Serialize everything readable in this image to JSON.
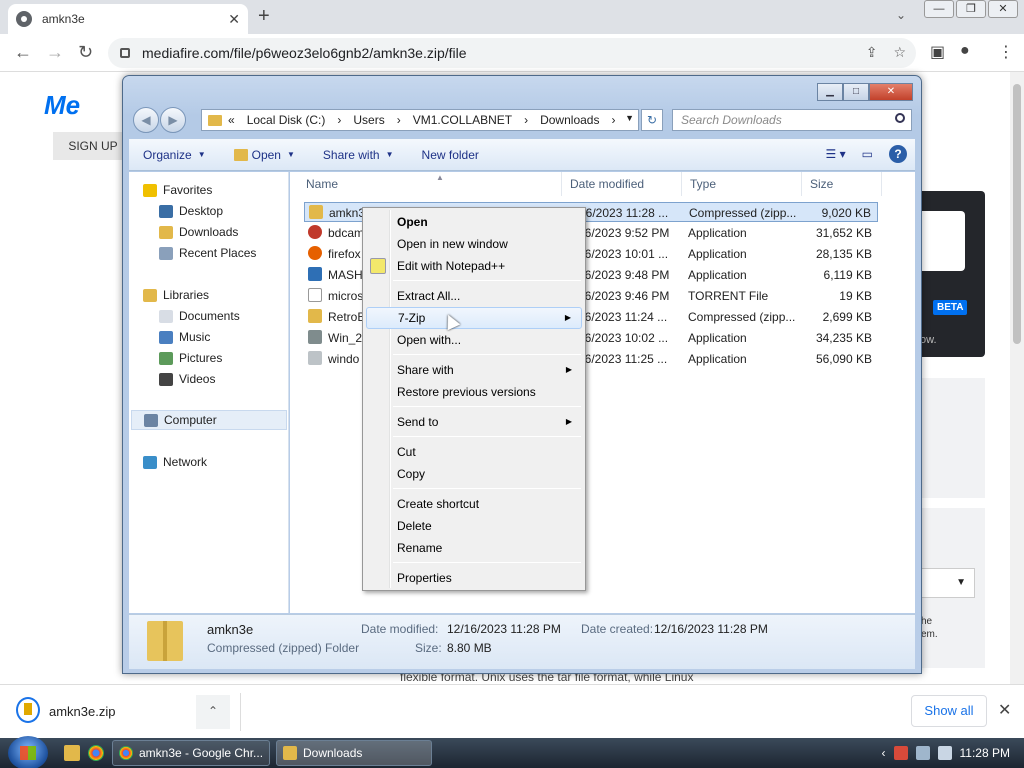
{
  "browser": {
    "tab_title": "amkn3e",
    "tab_close": "✕",
    "new_tab": "+",
    "url": "mediafire.com/file/p6weoz3elo6gnb2/amkn3e.zip/file",
    "back": "←",
    "forward": "→",
    "reload": "↻",
    "window_controls": [
      "—",
      "❐",
      "✕"
    ],
    "tab_dropdown": "⌄"
  },
  "page": {
    "logo": "Me",
    "signup": "SIGN UP",
    "beta": "BETA",
    "now_fragment": "ow.",
    "right_fragment": "he\nem.",
    "bottom_text": "flexible format. Unix uses the tar file format, while Linux"
  },
  "explorer": {
    "breadcrumbs": [
      "«",
      "Local Disk (C:)",
      "›",
      "Users",
      "›",
      "VM1.COLLABNET",
      "›",
      "Downloads",
      "›"
    ],
    "search_placeholder": "Search Downloads",
    "commands": {
      "organize": "Organize",
      "open": "Open",
      "share_with": "Share with",
      "new_folder": "New folder"
    },
    "nav": {
      "favorites": "Favorites",
      "desktop": "Desktop",
      "downloads": "Downloads",
      "recent_places": "Recent Places",
      "libraries": "Libraries",
      "documents": "Documents",
      "music": "Music",
      "pictures": "Pictures",
      "videos": "Videos",
      "computer": "Computer",
      "network": "Network"
    },
    "columns": {
      "name": "Name",
      "date": "Date modified",
      "type": "Type",
      "size": "Size"
    },
    "files": [
      {
        "name": "amkn3",
        "date": "16/2023 11:28 ...",
        "type": "Compressed (zipp...",
        "size": "9,020 KB"
      },
      {
        "name": "bdcam",
        "date": "16/2023 9:52 PM",
        "type": "Application",
        "size": "31,652 KB"
      },
      {
        "name": "firefox",
        "date": "16/2023 10:01 ...",
        "type": "Application",
        "size": "28,135 KB"
      },
      {
        "name": "MASH",
        "date": "16/2023 9:48 PM",
        "type": "Application",
        "size": "6,119 KB"
      },
      {
        "name": "micros",
        "date": "16/2023 9:46 PM",
        "type": "TORRENT File",
        "size": "19 KB"
      },
      {
        "name": "RetroB",
        "date": "16/2023 11:24 ...",
        "type": "Compressed (zipp...",
        "size": "2,699 KB"
      },
      {
        "name": "Win_2",
        "date": "16/2023 10:02 ...",
        "type": "Application",
        "size": "34,235 KB"
      },
      {
        "name": "windo",
        "date": "16/2023 11:25 ...",
        "type": "Application",
        "size": "56,090 KB"
      }
    ],
    "details": {
      "name": "amkn3e",
      "kind": "Compressed (zipped) Folder",
      "modified_label": "Date modified:",
      "modified_value": "12/16/2023 11:28 PM",
      "created_label": "Date created:",
      "created_value": "12/16/2023 11:28 PM",
      "size_label": "Size:",
      "size_value": "8.80 MB"
    }
  },
  "context_menu": {
    "open": "Open",
    "open_new_window": "Open in new window",
    "edit_notepad": "Edit with Notepad++",
    "extract_all": "Extract All...",
    "seven_zip": "7-Zip",
    "open_with": "Open with...",
    "share_with": "Share with",
    "restore_versions": "Restore previous versions",
    "send_to": "Send to",
    "cut": "Cut",
    "copy": "Copy",
    "create_shortcut": "Create shortcut",
    "delete": "Delete",
    "rename": "Rename",
    "properties": "Properties",
    "submenu_arrow": "▶"
  },
  "download_shelf": {
    "file": "amkn3e.zip",
    "chevron": "⌃",
    "show_all": "Show all",
    "close": "✕"
  },
  "taskbar": {
    "chrome_button": "amkn3e - Google Chr...",
    "explorer_button": "Downloads",
    "clock": "11:28 PM"
  }
}
